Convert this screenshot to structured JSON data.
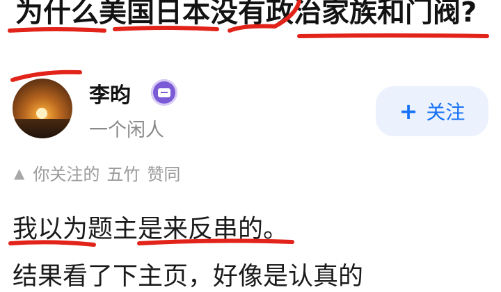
{
  "question": {
    "title": "为什么美国日本没有政治家族和门阀?"
  },
  "author": {
    "name": "李昀",
    "bio": "一个闲人"
  },
  "follow_button": {
    "plus": "+",
    "label": "关注"
  },
  "endorsement": {
    "prefix": "你关注的",
    "user": "五竹",
    "action": "赞同"
  },
  "answer": {
    "line1": "我以为题主是来反串的。",
    "line2": "结果看了下主页，好像是认真的"
  },
  "colors": {
    "accent": "#1772f6",
    "annotation": "#e2231a",
    "badge": "#7b5ad6"
  },
  "icons": [
    "badge-icon",
    "triangle-up-icon",
    "plus-icon"
  ]
}
